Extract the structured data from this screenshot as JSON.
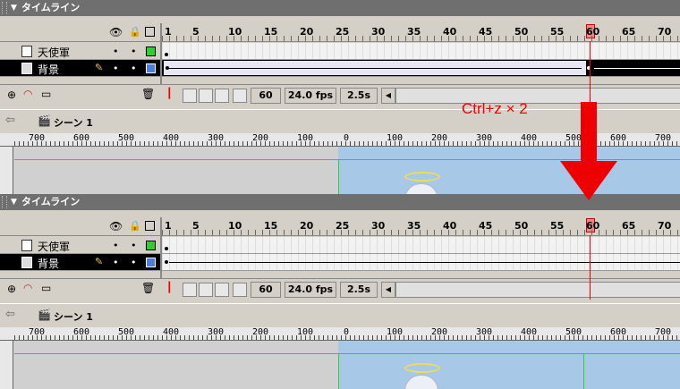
{
  "timeline": {
    "title": "タイムライン",
    "frame_numbers": [
      "1",
      "5",
      "10",
      "15",
      "20",
      "25",
      "30",
      "35",
      "40",
      "45",
      "50",
      "55",
      "60",
      "65",
      "70"
    ],
    "layers": [
      {
        "name": "天使軍",
        "selected": false
      },
      {
        "name": "背景",
        "selected": true
      }
    ],
    "current_frame": "60",
    "fps": "24.0 fps",
    "elapsed": "2.5s"
  },
  "scene": {
    "label": "シーン 1"
  },
  "ruler_labels": [
    "700",
    "600",
    "500",
    "400",
    "300",
    "200",
    "100",
    "0",
    "100",
    "200",
    "300",
    "400",
    "500",
    "600",
    "700"
  ],
  "annotation": {
    "text": "Ctrl+z × 2"
  },
  "colors": {
    "playhead": "#e00000",
    "arrow": "#e00000",
    "outline_green": "#33cc33",
    "selected_layer": "#000000"
  },
  "icons": [
    "eye-icon",
    "lock-icon",
    "outline-icon",
    "layer-icon",
    "pencil-icon",
    "insert-layer-icon",
    "add-guide-icon",
    "insert-folder-icon",
    "trash-icon",
    "back-arrow-icon",
    "scene-icon",
    "center-frame-icon",
    "onion-skin-icon",
    "onion-outline-icon",
    "edit-multiple-icon",
    "onion-markers-icon"
  ]
}
